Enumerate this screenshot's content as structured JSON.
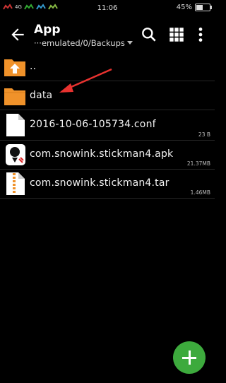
{
  "status": {
    "carrier_signal": "4G",
    "time": "11:06",
    "battery": "45%"
  },
  "toolbar": {
    "title": "App",
    "path": "···emulated/0/Backups"
  },
  "rows": [
    {
      "label": "..",
      "size": "",
      "icon": "folder-up-icon"
    },
    {
      "label": "data",
      "size": "",
      "icon": "folder-icon"
    },
    {
      "label": "2016-10-06-105734.conf",
      "size": "23 B",
      "icon": "file-icon"
    },
    {
      "label": "com.snowink.stickman4.apk",
      "size": "21.37MB",
      "icon": "apk-icon"
    },
    {
      "label": "com.snowink.stickman4.tar",
      "size": "1.46MB",
      "icon": "archive-icon"
    }
  ],
  "colors": {
    "folder": "#f0922a",
    "fab": "#3daa3d",
    "arrow": "#e8322f"
  }
}
